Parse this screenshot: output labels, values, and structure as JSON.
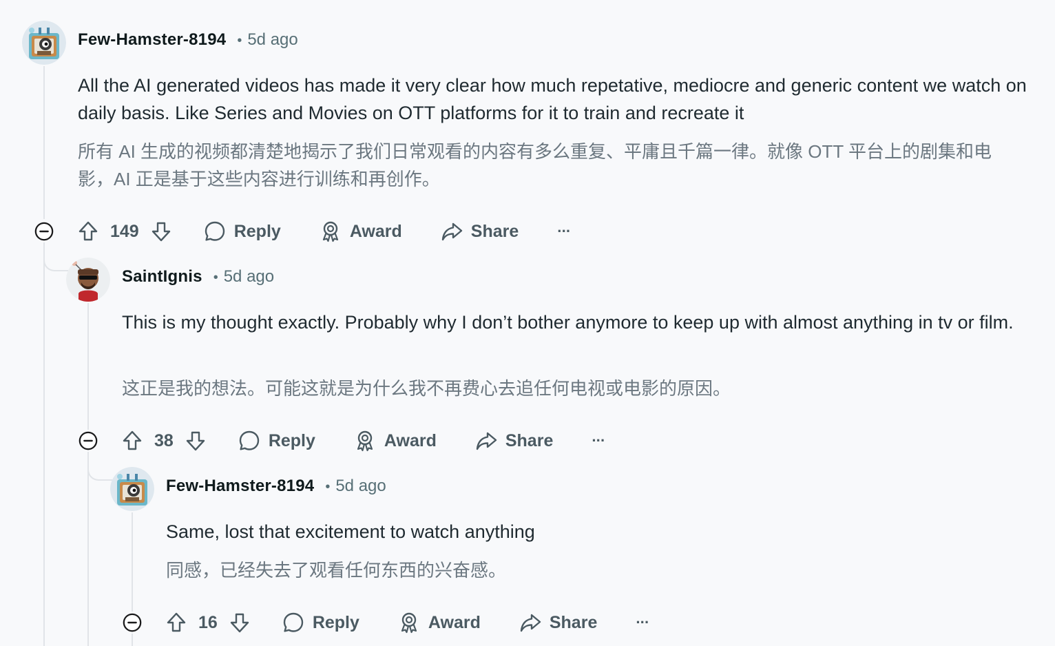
{
  "comments": [
    {
      "username": "Few-Hamster-8194",
      "separator": "•",
      "time": "5d ago",
      "body_en": "All the AI generated videos has made it very clear how much repetative, mediocre and generic content we watch on daily basis. Like Series and Movies on OTT platforms for it to train and recreate it",
      "body_zh": "所有 AI 生成的视频都清楚地揭示了我们日常观看的内容有多么重复、平庸且千篇一律。就像 OTT 平台上的剧集和电影，AI 正是基于这些内容进行训练和再创作。",
      "votes": "149",
      "reply_label": "Reply",
      "award_label": "Award",
      "share_label": "Share",
      "more_label": "···"
    },
    {
      "username": "SaintIgnis",
      "separator": "•",
      "time": "5d ago",
      "body_en": "This is my thought exactly. Probably why I don’t bother anymore to keep up with almost anything in tv or film.",
      "body_zh": "这正是我的想法。可能这就是为什么我不再费心去追任何电视或电影的原因。",
      "votes": "38",
      "reply_label": "Reply",
      "award_label": "Award",
      "share_label": "Share",
      "more_label": "···"
    },
    {
      "username": "Few-Hamster-8194",
      "separator": "•",
      "time": "5d ago",
      "body_en": "Same, lost that excitement to watch anything",
      "body_zh": "同感，已经失去了观看任何东西的兴奋感。",
      "votes": "16",
      "reply_label": "Reply",
      "award_label": "Award",
      "share_label": "Share",
      "more_label": "···"
    }
  ],
  "icons": {
    "upvote": "upvote-arrow-icon",
    "downvote": "downvote-arrow-icon",
    "reply": "speech-bubble-icon",
    "award": "award-ribbon-icon",
    "share": "share-arrow-icon",
    "collapse": "collapse-minus-icon",
    "more": "more-options-icon"
  }
}
